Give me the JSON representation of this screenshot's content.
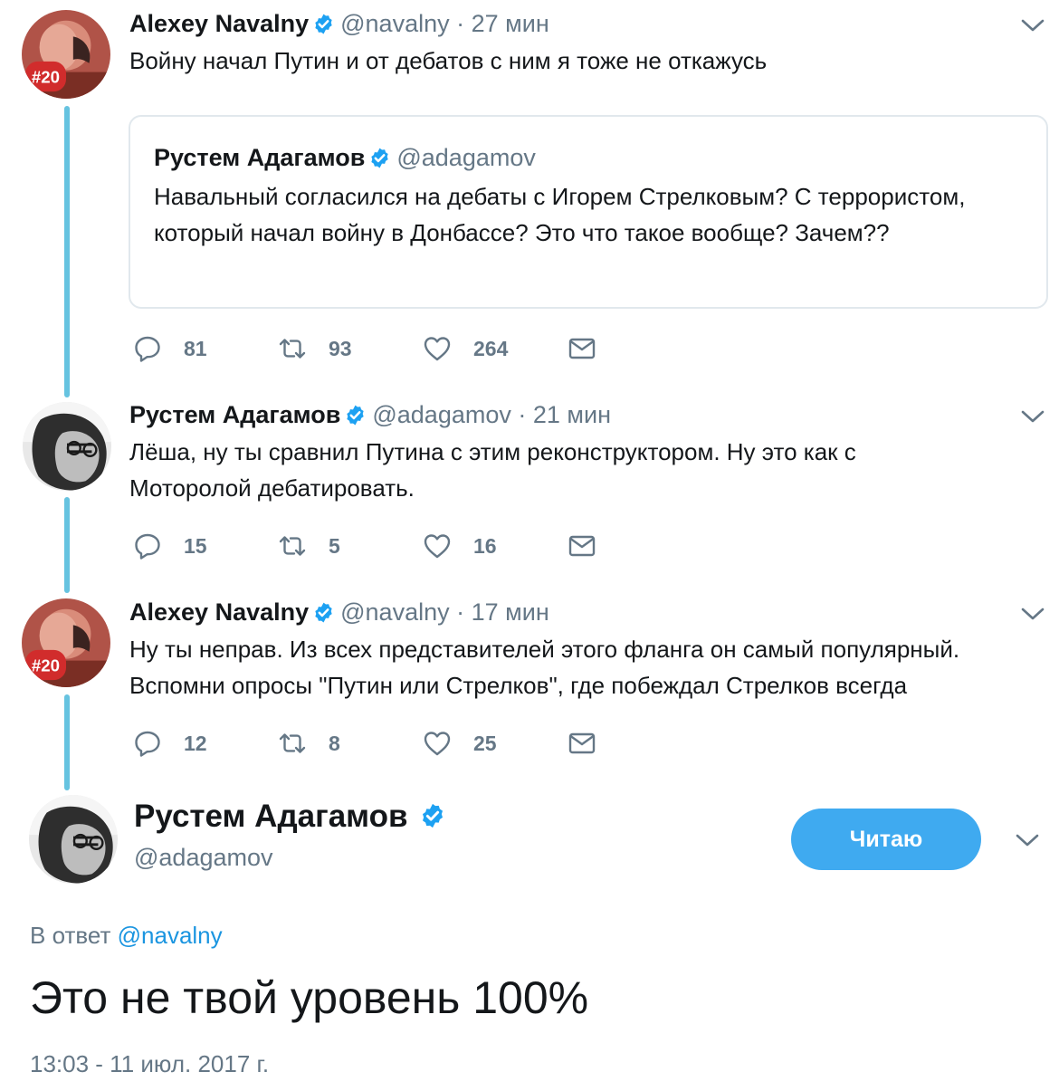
{
  "colors": {
    "accent": "#1da1f2",
    "button_bg": "#3faaf0",
    "thread_line": "#66c3e0",
    "muted_text": "#657786",
    "text": "#14171a",
    "border": "#e1e8ed"
  },
  "thread": [
    {
      "name": "Alexey Navalny",
      "handle": "@navalny",
      "separator": "·",
      "time": "27 мин",
      "text": "Войну начал Путин и от дебатов с ним я тоже не откажусь",
      "avatar_badge": "#20",
      "quote": {
        "name": "Рустем Адагамов",
        "handle": "@adagamov",
        "text": "Навальный согласился на дебаты с Игорем Стрелковым? С террористом, который начал войну в Донбассе? Это что такое вообще? Зачем??"
      },
      "replies": "81",
      "retweets": "93",
      "likes": "264"
    },
    {
      "name": "Рустем Адагамов",
      "handle": "@adagamov",
      "separator": "·",
      "time": "21 мин",
      "text": "Лёша, ну ты сравнил Путина с этим реконструктором. Ну это как с Моторолой дебатировать.",
      "replies": "15",
      "retweets": "5",
      "likes": "16"
    },
    {
      "name": "Alexey Navalny",
      "handle": "@navalny",
      "separator": "·",
      "time": "17 мин",
      "text": "Ну ты неправ. Из всех представителей этого фланга он самый популярный. Вспомни опросы \"Путин или Стрелков\", где побеждал Стрелков всегда",
      "avatar_badge": "#20",
      "replies": "12",
      "retweets": "8",
      "likes": "25"
    }
  ],
  "main_tweet": {
    "name": "Рустем Адагамов",
    "handle": "@adagamov",
    "follow_label": "Читаю",
    "reply_to_prefix": "В ответ",
    "reply_to_mention": "@navalny",
    "text": "Это не твой уровень 100%",
    "timestamp": "13:03 - 11 июл. 2017 г."
  },
  "icons": [
    "verified-badge-icon",
    "chevron-down-icon",
    "reply-icon",
    "retweet-icon",
    "like-icon",
    "message-icon"
  ]
}
